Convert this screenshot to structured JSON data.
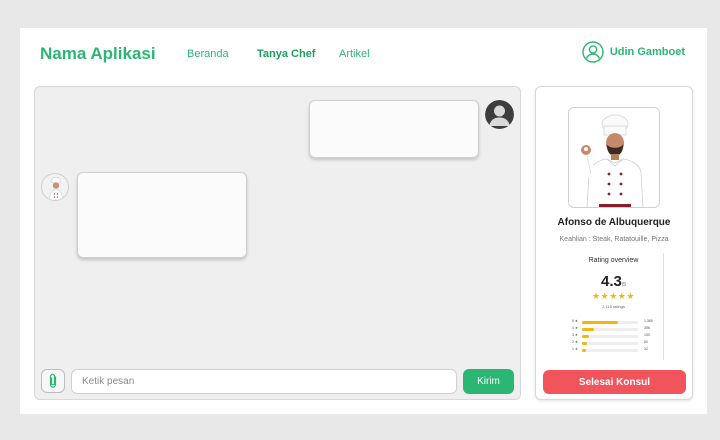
{
  "header": {
    "brand": "Nama Aplikasi",
    "nav": [
      {
        "label": "Beranda"
      },
      {
        "label": "Tanya Chef"
      },
      {
        "label": "Artikel"
      }
    ],
    "active_nav": "Tanya Chef",
    "user_name": "Udin Gamboet"
  },
  "chat": {
    "input_placeholder": "Ketik pesan",
    "input_value": "",
    "send_label": "Kirim"
  },
  "profile": {
    "name": "Afonso de Albuquerque",
    "skill": "Keahlian : Steak, Ratatouille, Pizza",
    "rating": {
      "title": "Rating overview",
      "score": "4.3",
      "max": "/5",
      "value": 4.3,
      "count": "2,115 ratings",
      "distribution": [
        {
          "label": "5 ★",
          "count": "1,365",
          "fraction": 0.65
        },
        {
          "label": "4 ★",
          "count": "356",
          "fraction": 0.22
        },
        {
          "label": "3 ★",
          "count": "150",
          "fraction": 0.12
        },
        {
          "label": "2 ★",
          "count": "80",
          "fraction": 0.09
        },
        {
          "label": "1 ★",
          "count": "32",
          "fraction": 0.07
        }
      ]
    },
    "end_label": "Selesai Konsul"
  },
  "colors": {
    "accent": "#2bb673",
    "danger": "#f2545b",
    "star": "#f5b50a"
  },
  "icons": {
    "user": "user-circle-icon",
    "attach": "paperclip-icon",
    "star": "star-icon"
  }
}
